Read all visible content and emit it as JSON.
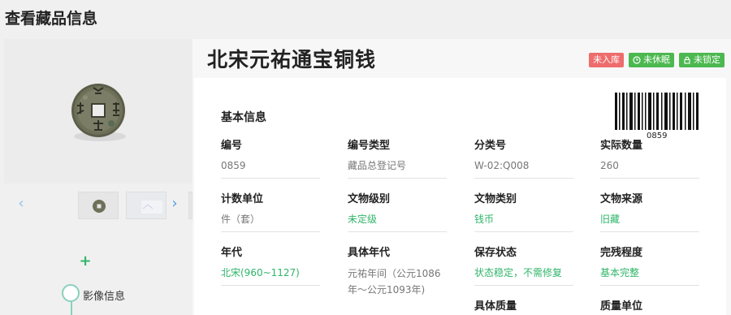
{
  "page": {
    "title": "查看藏品信息"
  },
  "gallery": {
    "prev_icon": "chevron-left-icon",
    "next_icon": "chevron-right-icon",
    "add_label": "+",
    "timeline_label": "影像信息"
  },
  "record": {
    "title": "北宋元祐通宝铜钱",
    "badges": [
      {
        "label": "未入库",
        "color": "#ef6c6c",
        "icon": ""
      },
      {
        "label": "未休眠",
        "color": "#4cb850",
        "icon": "clock-icon"
      },
      {
        "label": "未锁定",
        "color": "#4cb850",
        "icon": "lock-icon"
      }
    ],
    "section_title": "基本信息",
    "barcode_text": "0859",
    "fields": [
      {
        "label": "编号",
        "value": "0859",
        "green": false
      },
      {
        "label": "编号类型",
        "value": "藏品总登记号",
        "green": false
      },
      {
        "label": "分类号",
        "value": "W-02:Q008",
        "green": false
      },
      {
        "label": "实际数量",
        "value": "260",
        "green": false
      },
      {
        "label": "计数单位",
        "value": "件（套）",
        "green": false
      },
      {
        "label": "文物级别",
        "value": "未定级",
        "green": true
      },
      {
        "label": "文物类别",
        "value": "钱币",
        "green": true
      },
      {
        "label": "文物来源",
        "value": "旧藏",
        "green": true
      },
      {
        "label": "年代",
        "value": "北宋(960~1127)",
        "green": true
      },
      {
        "label": "具体年代",
        "value": "元祐年间（公元1086年～公元1093年)",
        "green": false
      },
      {
        "label": "保存状态",
        "value": "状态稳定，不需修复",
        "green": true
      },
      {
        "label": "完残程度",
        "value": "基本完整",
        "green": true
      },
      {
        "label": "具体质量",
        "value": "",
        "green": false
      },
      {
        "label": "质量单位",
        "value": "",
        "green": false
      }
    ]
  },
  "colors": {
    "accent_green": "#2fb56a",
    "badge_red": "#ef6c6c",
    "badge_green": "#4cb850",
    "link_blue": "#4aa0e6"
  }
}
